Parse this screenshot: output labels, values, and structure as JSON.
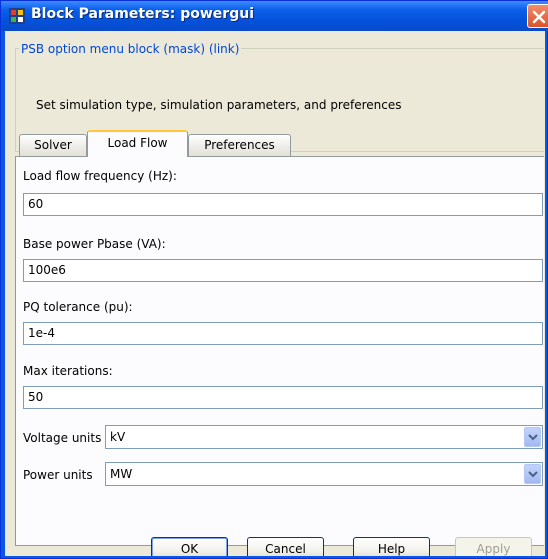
{
  "window": {
    "title": "Block Parameters: powergui"
  },
  "mask_group": {
    "legend": "PSB option menu block (mask) (link)",
    "description": "Set simulation type, simulation parameters, and preferences"
  },
  "tabs": [
    {
      "label": "Solver",
      "active": false
    },
    {
      "label": "Load Flow",
      "active": true
    },
    {
      "label": "Preferences",
      "active": false
    }
  ],
  "fields": {
    "frequency": {
      "label": "Load flow frequency (Hz):",
      "value": "60"
    },
    "base_power": {
      "label": "Base power Pbase (VA):",
      "value": "100e6"
    },
    "pq_tolerance": {
      "label": "PQ tolerance (pu):",
      "value": "1e-4"
    },
    "max_iterations": {
      "label": "Max iterations:",
      "value": "50"
    }
  },
  "selects": {
    "voltage_units": {
      "label": "Voltage units",
      "value": "kV"
    },
    "power_units": {
      "label": "Power units",
      "value": "MW"
    }
  },
  "buttons": {
    "ok": "OK",
    "cancel": "Cancel",
    "help": "Help",
    "apply": "Apply"
  },
  "colors": {
    "titlebar": "#0a57e6",
    "dialog_bg": "#ece9d8",
    "legend_text": "#0046d5",
    "active_tab_accent": "#ffc83c"
  },
  "icons": [
    "simulink-block-icon",
    "close-icon",
    "chevron-down-icon"
  ]
}
